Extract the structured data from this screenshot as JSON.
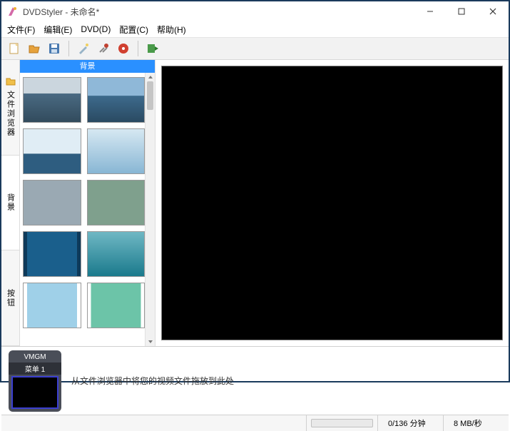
{
  "window": {
    "title": "DVDStyler - 未命名*"
  },
  "menubar": {
    "file": "文件(F)",
    "edit": "编辑(E)",
    "dvd": "DVD(D)",
    "config": "配置(C)",
    "help": "帮助(H)"
  },
  "toolbar": {
    "icons": [
      "new-icon",
      "open-icon",
      "save-icon",
      "sep",
      "tool1-icon",
      "settings-icon",
      "burn-icon",
      "sep",
      "run-icon"
    ]
  },
  "side_tabs": {
    "file_browser": "文件浏览器",
    "background": "背景",
    "buttons": "按钮"
  },
  "thumbs": {
    "category_label": "背景"
  },
  "vmgm": {
    "title": "VMGM",
    "menu_label": "菜单 1"
  },
  "drop_hint": "从文件浏览器中将您的视频文件拖放到此处",
  "status": {
    "duration": "0/136 分钟",
    "bitrate": "8 MB/秒"
  }
}
